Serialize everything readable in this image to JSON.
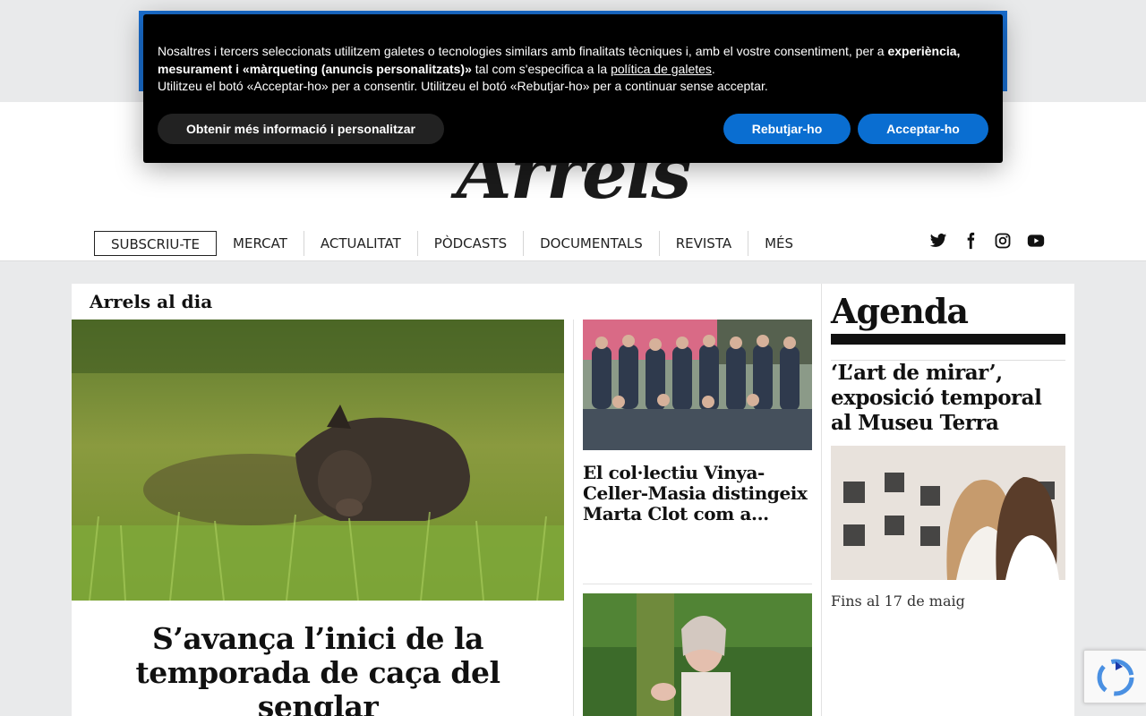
{
  "site": {
    "logo": "Arrels"
  },
  "nav": {
    "items": [
      "SUBSCRIU-TE",
      "MERCAT",
      "ACTUALITAT",
      "PÒDCASTS",
      "DOCUMENTALS",
      "REVISTA",
      "MÉS"
    ]
  },
  "social": [
    "twitter-icon",
    "facebook-icon",
    "instagram-icon",
    "youtube-icon"
  ],
  "cookie": {
    "text_a": "Nosaltres i tercers seleccionats utilitzem galetes o tecnologies similars amb finalitats tècniques i, amb el vostre consentiment, per a ",
    "text_b": "experiència, mesurament i «màrqueting (anuncis personalitzats)»",
    "text_c": " tal com s'especifica a la ",
    "link": "política de galetes",
    "text_d": ".",
    "text_e": "Utilitzeu el botó «Acceptar-ho» per a consentir. Utilitzeu el botó «Rebutjar-ho» per a continuar sense acceptar.",
    "more_label": "Obtenir més informació i personalitzar",
    "reject_label": "Rebutjar-ho",
    "accept_label": "Acceptar-ho"
  },
  "main": {
    "section_title": "Arrels al dia",
    "lead_title": "S’avança l’inici de la temporada de caça del senglar",
    "card1_title": "El col·lectiu Vinya-Celler-Masia distingeix Marta Clot com a..."
  },
  "agenda": {
    "title": "Agenda",
    "item_title": "‘L’art de mirar’, exposició temporal al Museu Terra",
    "item_date": "Fins al 17 de maig"
  },
  "colors": {
    "accent_blue": "#0a6ed1",
    "banner_bg": "#000000",
    "ad_frame": "#1a6fd1"
  }
}
